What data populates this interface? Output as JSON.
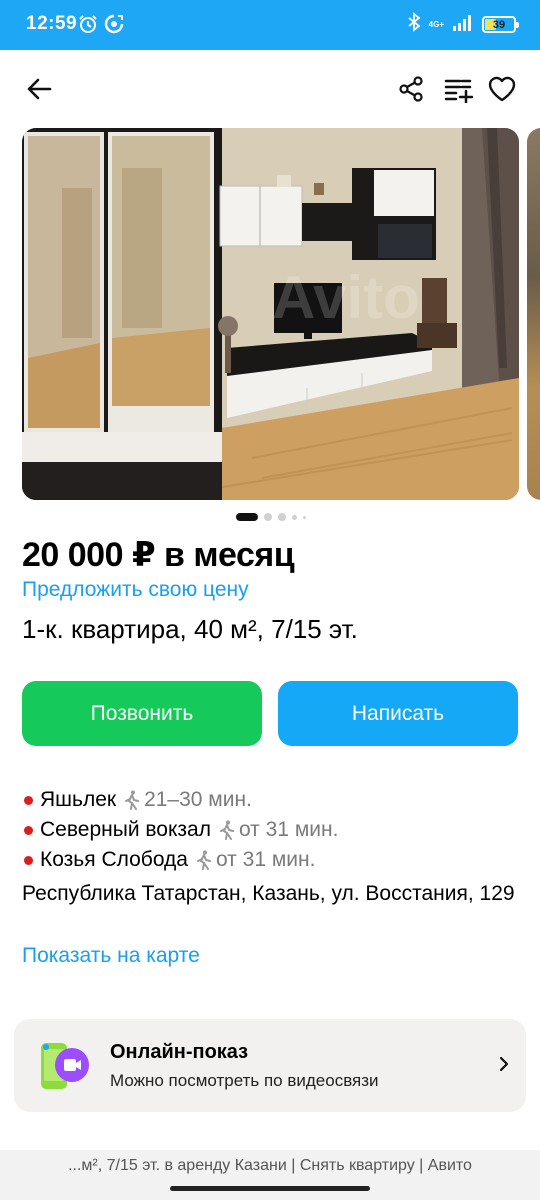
{
  "status_bar": {
    "time": "12:59",
    "network": "4G+",
    "battery": "39",
    "icons": [
      "alarm-icon",
      "sync-icon",
      "bluetooth-icon",
      "signal-icon",
      "battery-icon"
    ]
  },
  "toolbar": {
    "icons": [
      "back-arrow-icon",
      "share-icon",
      "compare-icon",
      "favorite-heart-icon"
    ]
  },
  "gallery": {
    "watermark": "Avito",
    "page_count": 5,
    "active_page": 1
  },
  "listing": {
    "price": "20 000 ₽ в месяц",
    "offer_price_link": "Предложить свою цену",
    "title": "1-к. квартира, 40 м², 7/15 эт."
  },
  "actions": {
    "call_label": "Позвонить",
    "write_label": "Написать"
  },
  "metro": [
    {
      "name": "Яшьлек",
      "time": "21–30 мин."
    },
    {
      "name": "Северный вокзал",
      "time": "от 31 мин."
    },
    {
      "name": "Козья Слобода",
      "time": "от 31 мин."
    }
  ],
  "address": "Республика Татарстан, Казань, ул. Восстания, 129",
  "map_link": "Показать на карте",
  "online_show": {
    "title": "Онлайн-показ",
    "subtitle": "Можно посмотреть по видеосвязи"
  },
  "footer_title": "...м², 7/15 эт. в аренду Казани | Снять квартиру | Авито",
  "colors": {
    "status_bar": "#1ea7f5",
    "link": "#1a9ff0",
    "call_button": "#15c95a",
    "write_button": "#14a8f7",
    "metro_dot": "#d81e1e"
  }
}
